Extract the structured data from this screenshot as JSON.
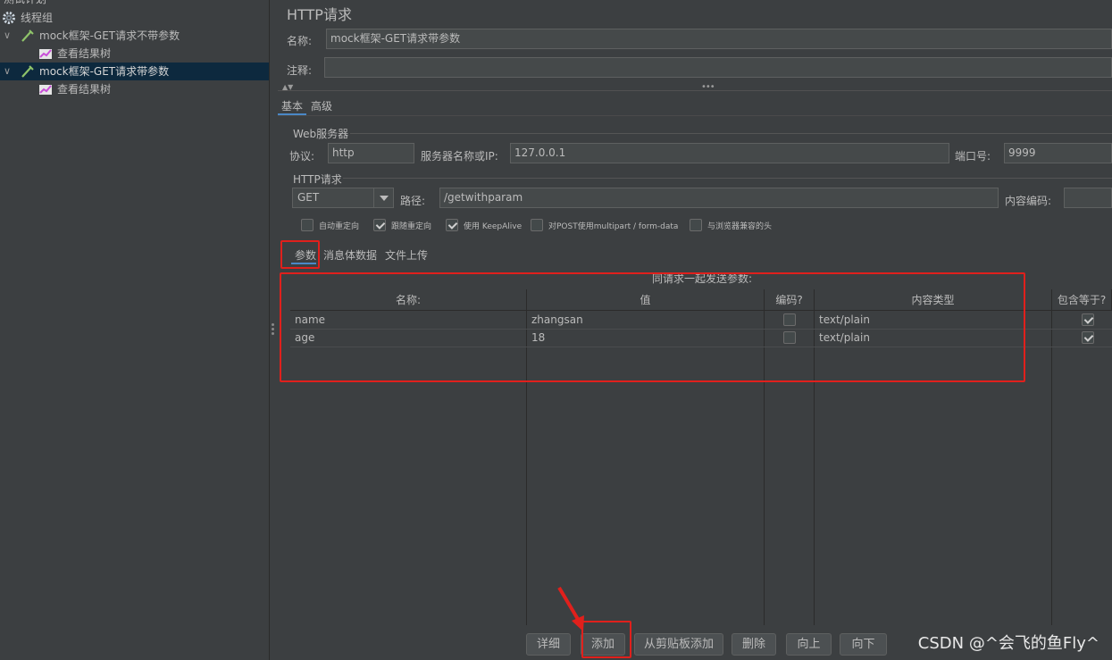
{
  "tree": {
    "root_partial_label": "测试计划",
    "items": [
      {
        "label": "线程组",
        "icon": "gear-icon"
      },
      {
        "label": "mock框架-GET请求不带参数",
        "icon": "pipette-icon",
        "expanded": true
      },
      {
        "label": "查看结果树",
        "icon": "chart-icon"
      },
      {
        "label": "mock框架-GET请求带参数",
        "icon": "pipette-icon",
        "expanded": true,
        "selected": true
      },
      {
        "label": "查看结果树",
        "icon": "chart-icon"
      }
    ]
  },
  "panel": {
    "title": "HTTP请求",
    "name_label": "名称:",
    "name_value": "mock框架-GET请求带参数",
    "comment_label": "注释:",
    "comment_value": ""
  },
  "tabs": {
    "basic": "基本",
    "advanced": "高级",
    "active": "basic"
  },
  "web_server": {
    "group_title": "Web服务器",
    "protocol_label": "协议:",
    "protocol_value": "http",
    "server_label": "服务器名称或IP:",
    "server_value": "127.0.0.1",
    "port_label": "端口号:",
    "port_value": "9999"
  },
  "http_request": {
    "group_title": "HTTP请求",
    "method": "GET",
    "path_label": "路径:",
    "path_value": "/getwithparam",
    "encoding_label": "内容编码:",
    "encoding_value": ""
  },
  "options": [
    {
      "label": "自动重定向",
      "checked": false
    },
    {
      "label": "跟随重定向",
      "checked": true
    },
    {
      "label": "使用 KeepAlive",
      "checked": true
    },
    {
      "label": "对POST使用multipart / form-data",
      "checked": false
    },
    {
      "label": "与浏览器兼容的头",
      "checked": false
    }
  ],
  "subtabs": {
    "params": "参数",
    "body": "消息体数据",
    "files": "文件上传",
    "active": "params"
  },
  "params_table": {
    "caption": "同请求一起发送参数:",
    "headers": {
      "name": "名称:",
      "value": "值",
      "encode": "编码?",
      "content_type": "内容类型",
      "include_equals": "包含等于?"
    },
    "rows": [
      {
        "name": "name",
        "value": "zhangsan",
        "encode": false,
        "content_type": "text/plain",
        "include_equals": true
      },
      {
        "name": "age",
        "value": "18",
        "encode": false,
        "content_type": "text/plain",
        "include_equals": true
      }
    ]
  },
  "buttons": {
    "detail": "详细",
    "add": "添加",
    "add_clipboard": "从剪贴板添加",
    "delete": "删除",
    "up": "向上",
    "down": "向下"
  },
  "watermark": "CSDN @^会飞的鱼Fly^",
  "colors": {
    "annotation": "#e0201c",
    "selection": "#0d293e",
    "tab_accent": "#4a88c7"
  }
}
